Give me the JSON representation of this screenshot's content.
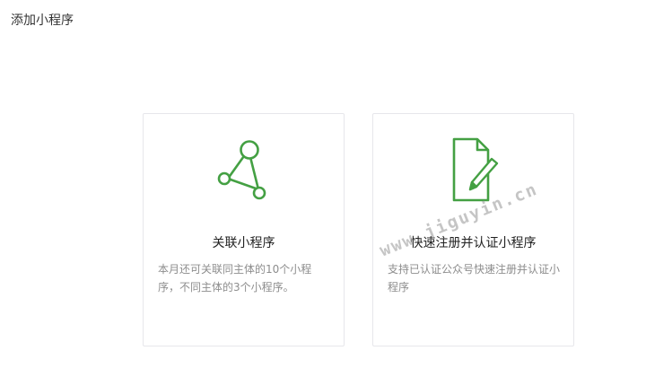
{
  "page": {
    "title": "添加小程序"
  },
  "colors": {
    "accent": "#44a043",
    "border": "#e7e7eb",
    "desc": "#8d8d8d"
  },
  "cards": [
    {
      "icon": "link-nodes-icon",
      "title": "关联小程序",
      "desc": "本月还可关联同主体的10个小程序，不同主体的3个小程序。"
    },
    {
      "icon": "document-edit-icon",
      "title": "快速注册并认证小程序",
      "desc": "支持已认证公众号快速注册并认证小程序"
    }
  ],
  "watermark": {
    "text": "www.jiguyin.cn"
  }
}
